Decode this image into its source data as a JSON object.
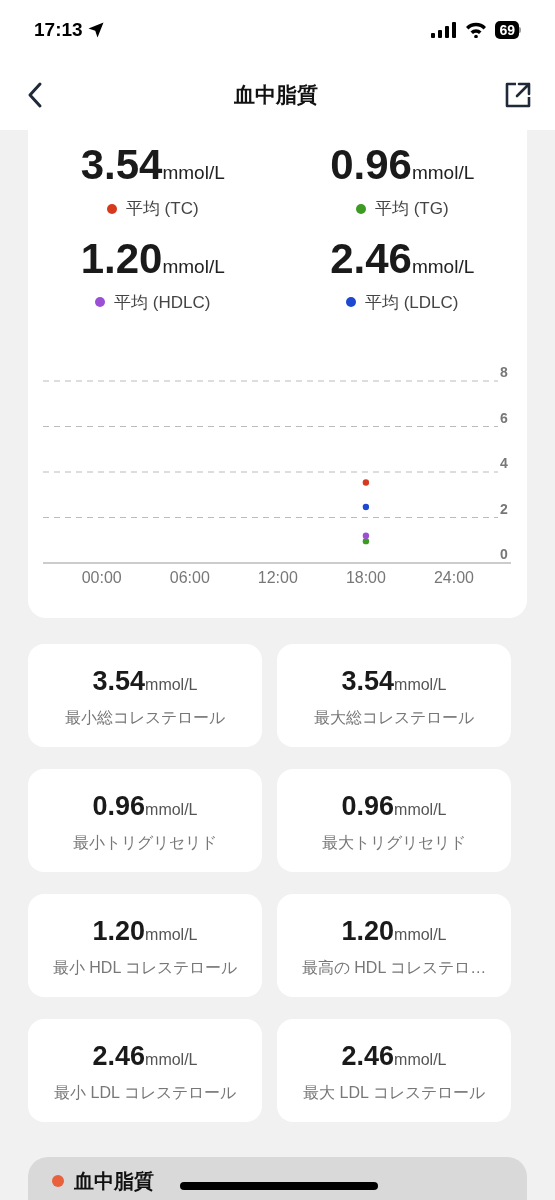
{
  "status_bar": {
    "time": "17:13",
    "battery": "69"
  },
  "header": {
    "title": "血中脂質"
  },
  "averages": [
    {
      "value": "3.54",
      "unit": "mmol/L",
      "label": "平均 (TC)",
      "color": "#d7391f"
    },
    {
      "value": "0.96",
      "unit": "mmol/L",
      "label": "平均 (TG)",
      "color": "#3d9a22"
    },
    {
      "value": "1.20",
      "unit": "mmol/L",
      "label": "平均 (HDLC)",
      "color": "#9b4fd6"
    },
    {
      "value": "2.46",
      "unit": "mmol/L",
      "label": "平均 (LDLC)",
      "color": "#1c48d2"
    }
  ],
  "chart": {
    "chart_data": {
      "type": "scatter",
      "x": [
        18
      ],
      "xlim": [
        -4,
        27
      ],
      "ylim": [
        0,
        8
      ],
      "xticks": [
        {
          "value": 0,
          "label": "00:00"
        },
        {
          "value": 6,
          "label": "06:00"
        },
        {
          "value": 12,
          "label": "12:00"
        },
        {
          "value": 18,
          "label": "18:00"
        },
        {
          "value": 24,
          "label": "24:00"
        }
      ],
      "yticks": [
        0,
        2,
        4,
        6,
        8
      ],
      "grid": true,
      "series": [
        {
          "color": "#d7391f",
          "values": [
            3.54
          ]
        },
        {
          "color": "#3d9a22",
          "values": [
            0.96
          ]
        },
        {
          "color": "#9b4fd6",
          "values": [
            1.2
          ]
        },
        {
          "color": "#1c48d2",
          "values": [
            2.46
          ]
        }
      ]
    }
  },
  "stat_cards": [
    {
      "value": "3.54",
      "unit": "mmol/L",
      "label": "最小総コレステロール"
    },
    {
      "value": "3.54",
      "unit": "mmol/L",
      "label": "最大総コレステロール"
    },
    {
      "value": "0.96",
      "unit": "mmol/L",
      "label": "最小トリグリセリド"
    },
    {
      "value": "0.96",
      "unit": "mmol/L",
      "label": "最大トリグリセリド"
    },
    {
      "value": "1.20",
      "unit": "mmol/L",
      "label": "最小 HDL コレステロール"
    },
    {
      "value": "1.20",
      "unit": "mmol/L",
      "label": "最高の HDL コレステロ…"
    },
    {
      "value": "2.46",
      "unit": "mmol/L",
      "label": "最小 LDL コレステロール"
    },
    {
      "value": "2.46",
      "unit": "mmol/L",
      "label": "最大 LDL コレステロール"
    }
  ],
  "bottom_section": {
    "title": "血中脂質"
  }
}
